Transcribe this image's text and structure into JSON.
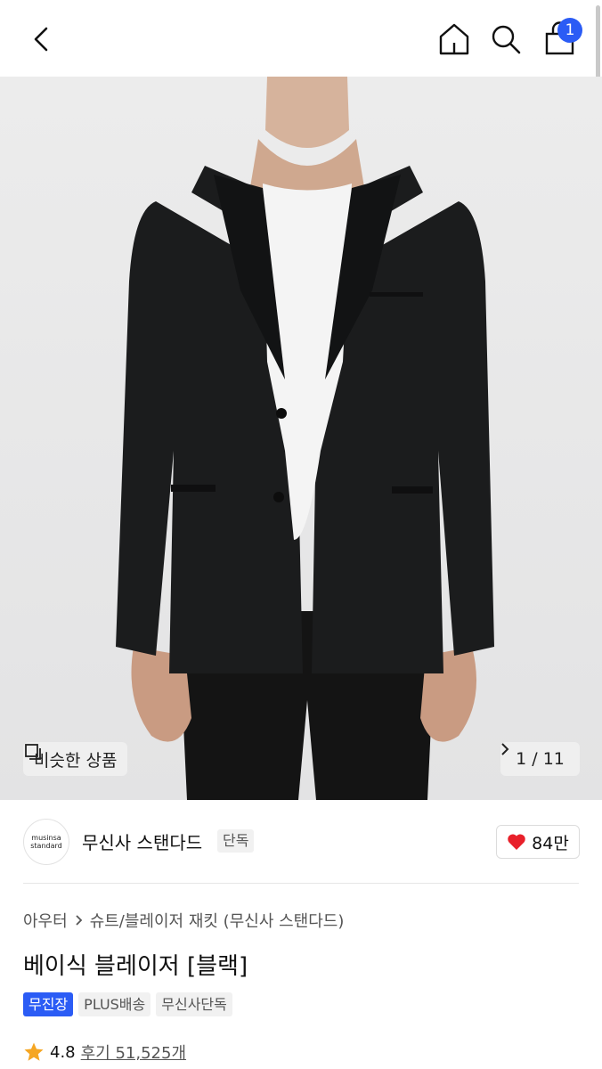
{
  "header": {
    "cart_count": "1"
  },
  "gallery": {
    "similar_label": "비슷한 상품",
    "counter": "1 / 11"
  },
  "brand": {
    "logo_line1": "musinsa",
    "logo_line2": "standard",
    "name": "무신사 스탠다드",
    "exclusive_tag": "단독",
    "likes": "84만"
  },
  "product": {
    "breadcrumb": [
      "아우터",
      "슈트/블레이저 재킷 (무신사 스탠다드)"
    ],
    "title": "베이식 블레이저 [블랙]",
    "tags": [
      "무진장",
      "PLUS배송",
      "무신사단독"
    ],
    "rating": "4.8",
    "reviews": "후기 51,525개"
  },
  "colors": {
    "accent": "#2b5cf5",
    "heart": "#e8202a",
    "star": "#f5a623"
  }
}
